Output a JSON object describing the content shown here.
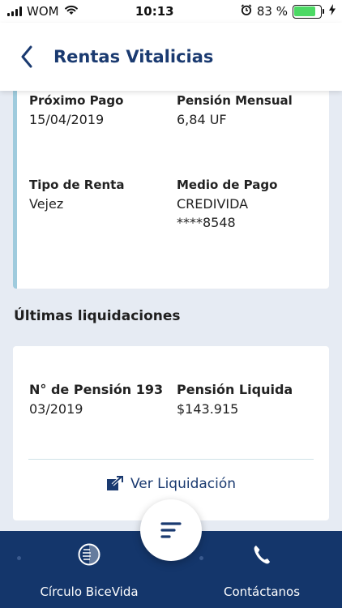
{
  "status_bar": {
    "carrier": "WOM",
    "time": "10:13",
    "battery_percent": "83 %",
    "battery_level": 0.83
  },
  "header": {
    "title": "Rentas Vitalicias"
  },
  "summary_card": {
    "next_payment_label": "Próximo Pago",
    "next_payment_value": "15/04/2019",
    "monthly_pension_label": "Pensión Mensual",
    "monthly_pension_value": "6,84 UF",
    "rent_type_label": "Tipo de Renta",
    "rent_type_value": "Vejez",
    "payment_method_label": "Medio de Pago",
    "payment_method_value": "CREDIVIDA",
    "payment_method_account": "****8548"
  },
  "settlements": {
    "section_title": "Últimas liquidaciones",
    "pension_number_label": "N° de Pensión 193",
    "period_value": "03/2019",
    "net_pension_label": "Pensión Liquida",
    "net_pension_value": "$143.915",
    "view_link_label": "Ver Liquidación"
  },
  "bottom_nav": {
    "left_label": "Círculo BiceVida",
    "right_label": "Contáctanos"
  },
  "colors": {
    "brand_navy": "#14366b",
    "title_blue": "#1a3a70",
    "card_accent": "#9fcbdd",
    "battery_green": "#4cd964",
    "background": "#e6ebf3"
  },
  "icons": {
    "back": "chevron-left-icon",
    "open_link": "external-link-icon",
    "menu": "menu-lines-icon",
    "circle": "circle-bicevida-icon",
    "phone": "phone-icon",
    "wifi": "wifi-icon",
    "alarm": "alarm-icon",
    "charging": "charging-bolt-icon"
  }
}
